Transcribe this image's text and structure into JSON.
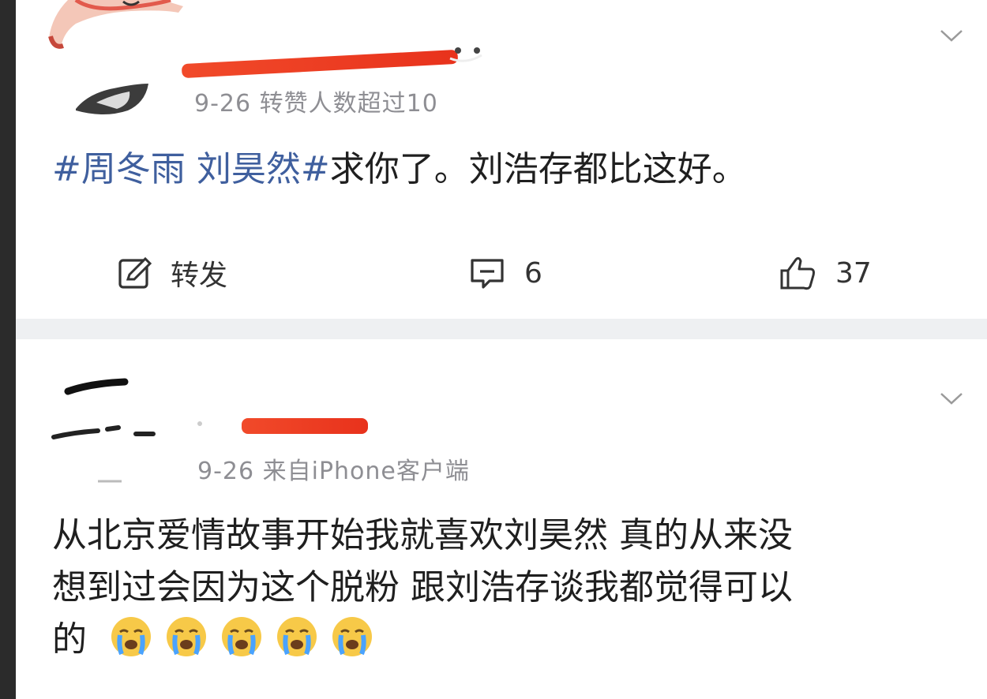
{
  "post1": {
    "meta": "9-26 转赞人数超过10",
    "hashtag": "#周冬雨 刘昊然#",
    "text": "求你了。刘浩存都比这好。",
    "actions": {
      "repost_label": "转发",
      "comment_count": "6",
      "like_count": "37"
    }
  },
  "post2": {
    "meta": "9-26 来自iPhone客户端",
    "line1": "从北京爱情故事开始我就喜欢刘昊然 真的从来没",
    "line2": "想到过会因为这个脱粉 跟刘浩存谈我都觉得可以",
    "line3": "的",
    "emojis": [
      "crying-emoji",
      "crying-emoji",
      "crying-emoji",
      "crying-emoji",
      "crying-emoji"
    ]
  },
  "colors": {
    "hashtag": "#3f5f9e",
    "meta": "#8e8e93",
    "redaction": "#f14a2a"
  }
}
